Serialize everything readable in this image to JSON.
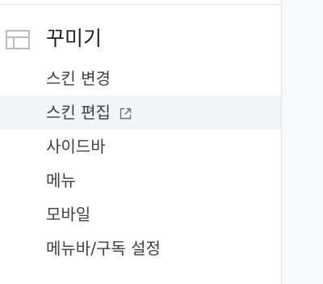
{
  "sidebar": {
    "section": {
      "title": "꾸미기",
      "icon": "layout-icon"
    },
    "items": [
      {
        "label": "스킨 변경",
        "active": false
      },
      {
        "label": "스킨 편집",
        "active": true,
        "icon": "external-link-icon"
      },
      {
        "label": "사이드바",
        "active": false
      },
      {
        "label": "메뉴",
        "active": false
      },
      {
        "label": "모바일",
        "active": false
      },
      {
        "label": "메뉴바/구독 설정",
        "active": false
      }
    ]
  },
  "colors": {
    "active_row_bg": "#f3f4f6",
    "icon_gray": "#bcbcbc",
    "content_bg": "#f7f8fa"
  }
}
